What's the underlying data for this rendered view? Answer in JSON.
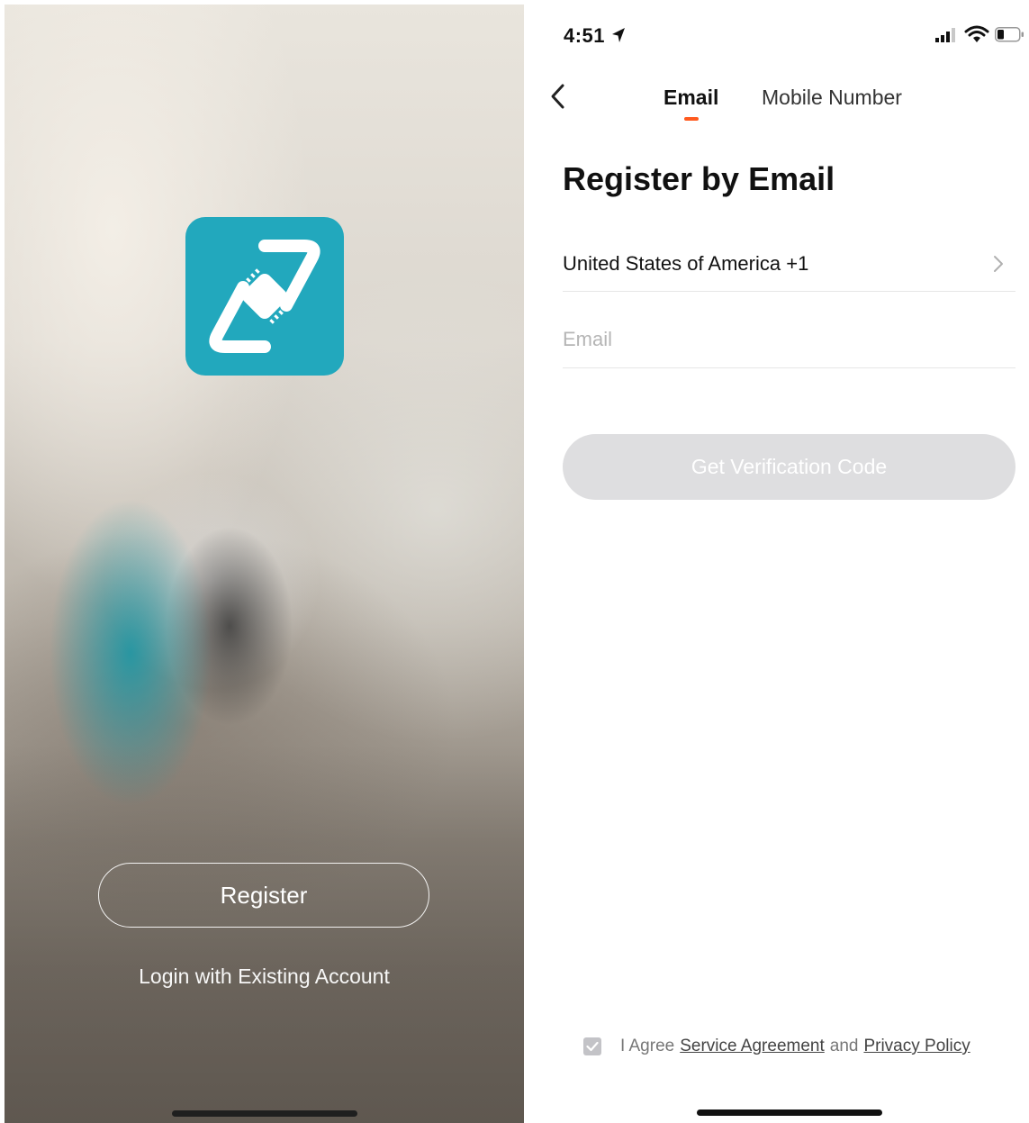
{
  "welcome_screen": {
    "register_label": "Register",
    "login_label": "Login with Existing Account",
    "app_icon_color": "#22a8bd"
  },
  "register_screen": {
    "status_bar": {
      "time": "4:51",
      "icons": [
        "location-arrow-icon",
        "cellular-signal-icon",
        "wifi-icon",
        "battery-icon"
      ]
    },
    "tabs": [
      {
        "label": "Email",
        "active": true
      },
      {
        "label": "Mobile Number",
        "active": false
      }
    ],
    "accent_color": "#ff5a1f",
    "title": "Register by Email",
    "country": "United States of America +1",
    "email_placeholder": "Email",
    "email_value": "",
    "verify_button_label": "Get Verification Code",
    "agreement": {
      "checked": true,
      "prefix": "I Agree",
      "service_link": "Service Agreement",
      "conjunction": "and",
      "privacy_link": "Privacy Policy"
    }
  }
}
